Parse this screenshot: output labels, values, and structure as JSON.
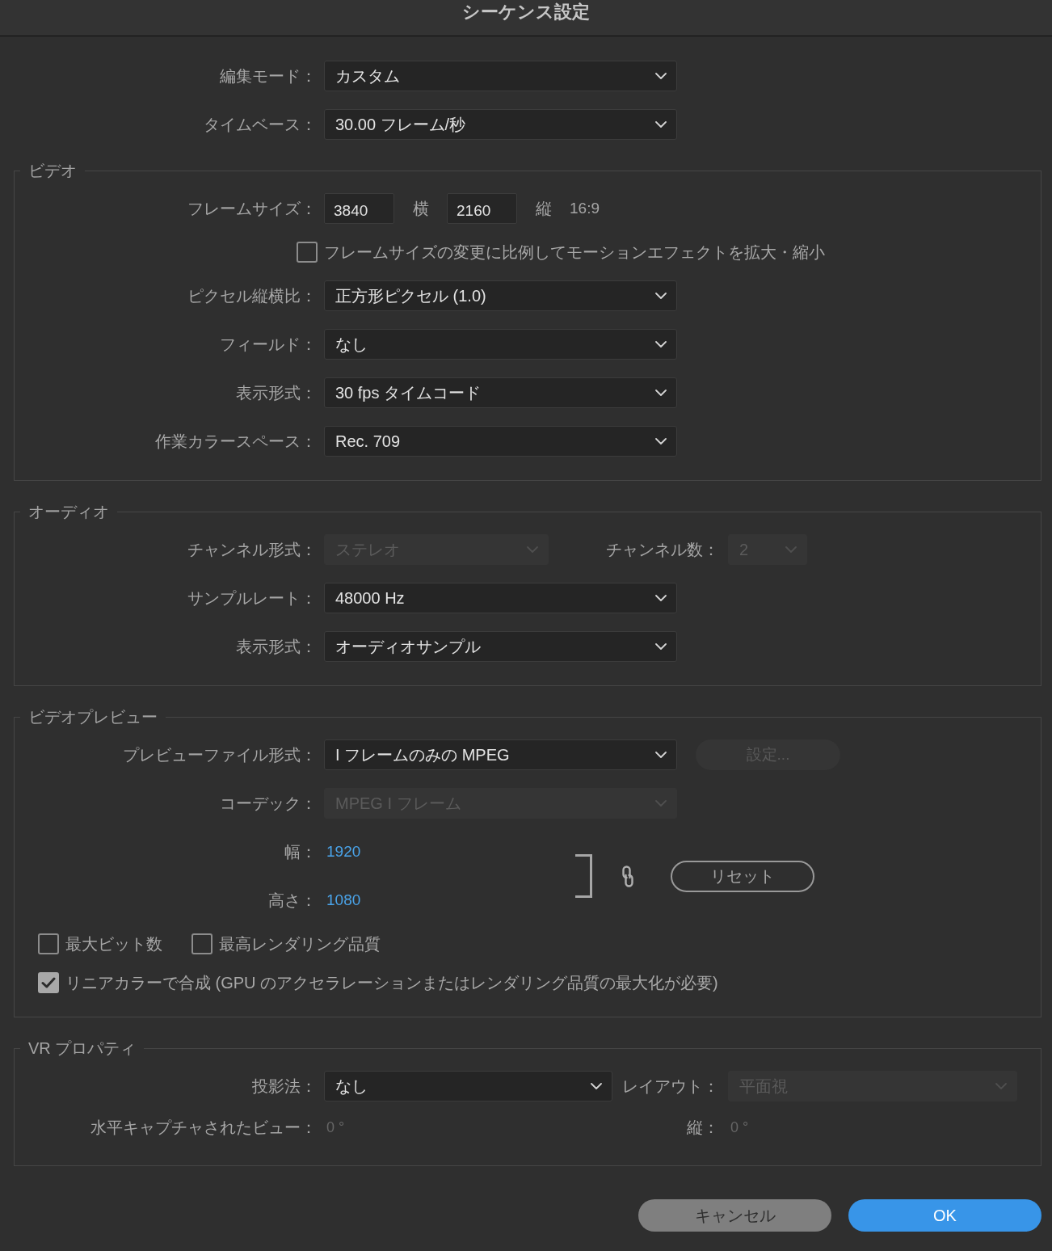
{
  "window": {
    "title": "シーケンス設定"
  },
  "general": [
    {
      "kind": "dropdown",
      "label": "編集モード：",
      "value": "カスタム",
      "disabled": false
    },
    {
      "kind": "dropdown",
      "label": "タイムベース：",
      "value": "30.00 フレーム/秒",
      "disabled": false
    }
  ],
  "sections": [
    {
      "legend": "ビデオ",
      "rows": [
        {
          "kind": "frame_size",
          "label": "フレームサイズ：",
          "fields": [
            {
              "value": "3840",
              "unit": "横"
            },
            {
              "value": "2160",
              "unit": "縦"
            }
          ],
          "aspect": "16:9"
        },
        {
          "kind": "aligned_checkbox",
          "items": [
            {
              "label": "フレームサイズの変更に比例してモーションエフェクトを拡大・縮小",
              "checked": false
            }
          ]
        },
        {
          "kind": "dropdown",
          "label": "ピクセル縦横比：",
          "value": "正方形ピクセル (1.0)",
          "disabled": false
        },
        {
          "kind": "dropdown",
          "label": "フィールド：",
          "value": "なし",
          "disabled": false
        },
        {
          "kind": "dropdown",
          "label": "表示形式：",
          "value": "30 fps タイムコード",
          "disabled": false
        },
        {
          "kind": "dropdown",
          "label": "作業カラースペース：",
          "value": "Rec. 709",
          "disabled": false
        }
      ]
    },
    {
      "legend": "オーディオ",
      "rows": [
        {
          "kind": "audio_channels",
          "items": [
            {
              "label": "チャンネル形式：",
              "value": "ステレオ",
              "disabled": true
            },
            {
              "label": "チャンネル数：",
              "value": "2",
              "disabled": true
            }
          ]
        },
        {
          "kind": "dropdown",
          "label": "サンプルレート：",
          "value": "48000 Hz",
          "disabled": false
        },
        {
          "kind": "dropdown",
          "label": "表示形式：",
          "value": "オーディオサンプル",
          "disabled": false
        }
      ]
    },
    {
      "legend": "ビデオプレビュー",
      "rows": [
        {
          "kind": "dropdown",
          "label": "プレビューファイル形式：",
          "value": "I フレームのみの MPEG",
          "disabled": false,
          "button": {
            "label": "設定...",
            "disabled": true
          }
        },
        {
          "kind": "dropdown",
          "label": "コーデック：",
          "value": "MPEG I フレーム",
          "disabled": true
        },
        {
          "kind": "dimensions",
          "items": [
            {
              "label": "幅：",
              "value": "1920",
              "disabled": false
            },
            {
              "label": "高さ：",
              "value": "1080",
              "disabled": false
            }
          ],
          "linked": true,
          "reset": "リセット"
        },
        {
          "kind": "checkbox_row",
          "items": [
            {
              "label": "最大ビット数",
              "checked": false
            },
            {
              "label": "最高レンダリング品質",
              "checked": false
            }
          ]
        },
        {
          "kind": "checkbox_row",
          "items": [
            {
              "label": "リニアカラーで合成 (GPU のアクセラレーションまたはレンダリング品質の最大化が必要)",
              "checked": true
            }
          ]
        }
      ]
    },
    {
      "legend": "VR プロパティ",
      "rows": [
        {
          "kind": "projection",
          "items": [
            {
              "label": "投影法：",
              "value": "なし",
              "disabled": false
            },
            {
              "label": "レイアウト：",
              "value": "平面視",
              "disabled": true
            }
          ]
        },
        {
          "kind": "readout_pair",
          "items": [
            {
              "label": "水平キャプチャされたビュー：",
              "value": "0 °",
              "disabled": true
            },
            {
              "label": "縦：",
              "value": "0 °",
              "disabled": true
            }
          ]
        }
      ]
    }
  ],
  "buttons": [
    {
      "label": "キャンセル",
      "kind": "secondary"
    },
    {
      "label": "OK",
      "kind": "primary"
    }
  ]
}
